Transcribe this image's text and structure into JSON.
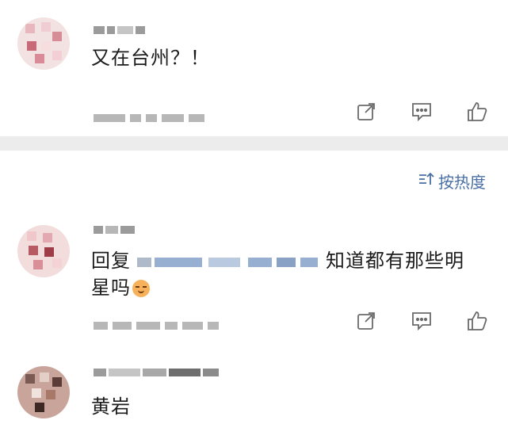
{
  "comments": [
    {
      "text": "又在台州？！"
    },
    {
      "reply_prefix": "回复",
      "text": "知道都有那些明",
      "text_line2": "星吗"
    },
    {
      "text": "黄岩"
    }
  ],
  "sort": {
    "label": "按热度",
    "icon": "sort-icon"
  },
  "icons": {
    "share": "share-icon",
    "comment": "comment-icon",
    "like": "thumb-up-icon"
  },
  "colors": {
    "link": "#4a6fa5",
    "divider": "#ececec",
    "text": "#1b1b1b"
  }
}
